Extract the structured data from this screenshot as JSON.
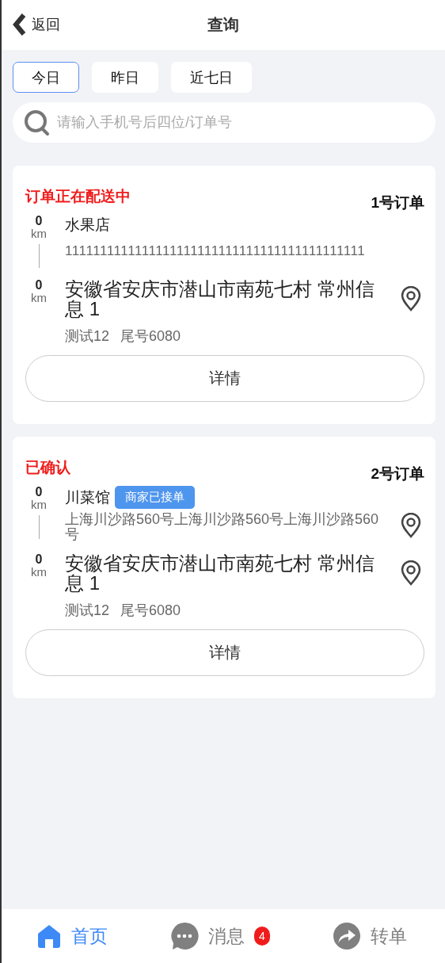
{
  "header": {
    "back_label": "返回",
    "title": "查询"
  },
  "date_tabs": [
    {
      "label": "今日",
      "selected": true
    },
    {
      "label": "昨日",
      "selected": false
    },
    {
      "label": "近七日",
      "selected": false
    }
  ],
  "search": {
    "placeholder": "请输入手机号后四位/订单号"
  },
  "orders": [
    {
      "status": "订单正在配送中",
      "number": "1号订单",
      "pickup": {
        "distance": "0",
        "unit": "km",
        "name": "水果店",
        "address": "1111111111111111111111111111111111111111111",
        "location_icon": false
      },
      "dropoff": {
        "distance": "0",
        "unit": "km",
        "address": "安徽省安庆市潜山市南苑七村 常州信息 1",
        "location_icon": true
      },
      "customer": "测试12",
      "phone_tail": "尾号6080",
      "button": "详情"
    },
    {
      "status": "已确认",
      "number": "2号订单",
      "pickup": {
        "distance": "0",
        "unit": "km",
        "name": "川菜馆",
        "badge": "商家已接单",
        "address": "上海川沙路560号上海川沙路560号上海川沙路560号",
        "location_icon": true
      },
      "dropoff": {
        "distance": "0",
        "unit": "km",
        "address": "安徽省安庆市潜山市南苑七村 常州信息 1",
        "location_icon": true
      },
      "customer": "测试12",
      "phone_tail": "尾号6080",
      "button": "详情"
    }
  ],
  "tab_bar": [
    {
      "kind": "home",
      "label": "首页",
      "selected": true
    },
    {
      "kind": "message",
      "label": "消息",
      "badge": "4",
      "selected": false
    },
    {
      "kind": "transfer",
      "label": "转单",
      "selected": false
    }
  ]
}
